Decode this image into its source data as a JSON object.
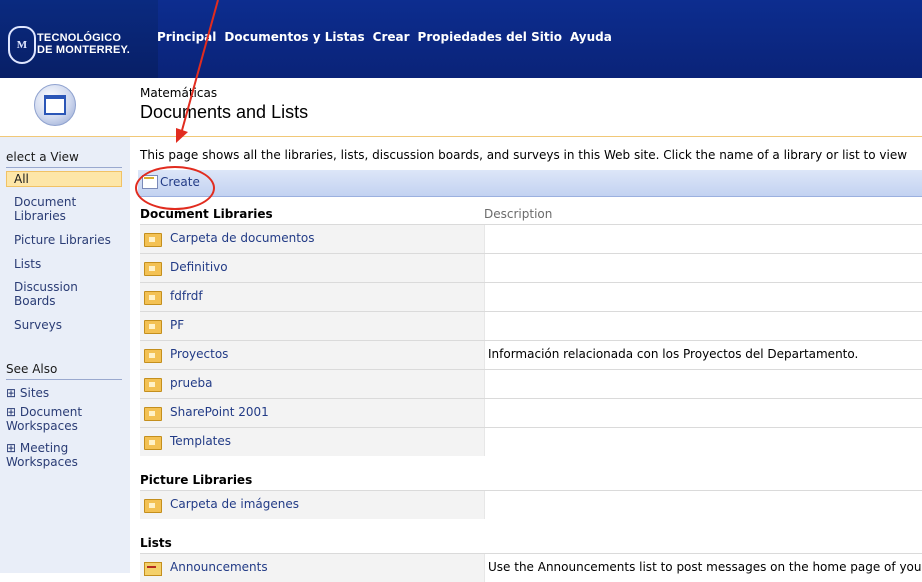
{
  "header": {
    "logo_line1": "TECNOLÓGICO",
    "logo_line2": "DE MONTERREY.",
    "nav": [
      "Principal",
      "Documentos y Listas",
      "Crear",
      "Propiedades del Sitio",
      "Ayuda"
    ]
  },
  "site": {
    "name": "Matemáticas",
    "page_title": "Documents and Lists"
  },
  "sidebar": {
    "select_view_heading": "elect a View",
    "views": [
      {
        "label": "All",
        "selected": true
      },
      {
        "label": "Document Libraries"
      },
      {
        "label": "Picture Libraries"
      },
      {
        "label": "Lists"
      },
      {
        "label": "Discussion Boards"
      },
      {
        "label": "Surveys"
      }
    ],
    "see_also_heading": "See Also",
    "see_also": [
      "Sites",
      "Document Workspaces",
      "Meeting Workspaces"
    ]
  },
  "intro_text": "This page shows all the libraries, lists, discussion boards, and surveys in this Web site. Click the name of a library or list to view",
  "toolbar": {
    "create_label": "Create"
  },
  "document_libraries": {
    "heading": "Document Libraries",
    "description_header": "Description",
    "items": [
      {
        "name": "Carpeta de documentos",
        "description": ""
      },
      {
        "name": "Definitivo",
        "description": ""
      },
      {
        "name": "fdfrdf",
        "description": ""
      },
      {
        "name": "PF",
        "description": ""
      },
      {
        "name": "Proyectos",
        "description": "Información relacionada con los Proyectos del Departamento."
      },
      {
        "name": "prueba",
        "description": ""
      },
      {
        "name": "SharePoint 2001",
        "description": ""
      },
      {
        "name": "Templates",
        "description": ""
      }
    ]
  },
  "picture_libraries": {
    "heading": "Picture Libraries",
    "items": [
      {
        "name": "Carpeta de imágenes",
        "description": ""
      }
    ]
  },
  "lists": {
    "heading": "Lists",
    "items": [
      {
        "name": "Announcements",
        "description": "Use the Announcements list to post messages on the home page of you"
      }
    ]
  },
  "colors": {
    "header_blue": "#0d2d8f",
    "accent_red": "#e12c1f",
    "link_blue": "#223b86",
    "selected_bg": "#fde6a8"
  }
}
